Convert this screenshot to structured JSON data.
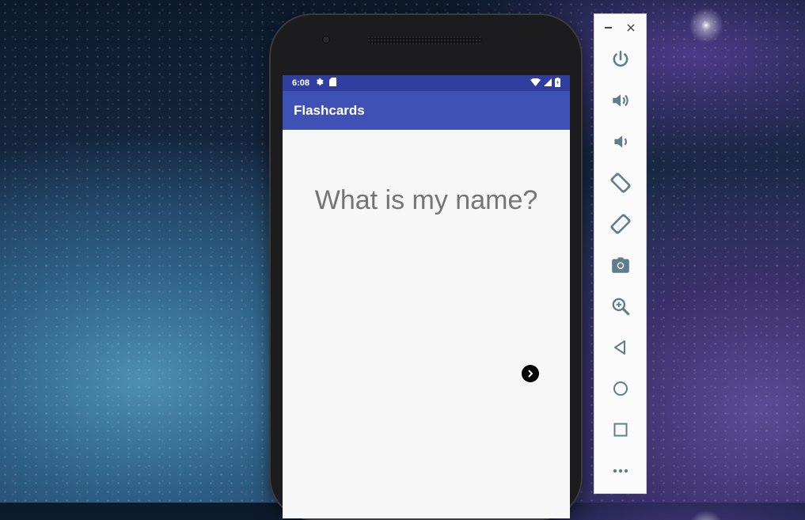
{
  "status_bar": {
    "time": "6:08",
    "left_icons": [
      "settings-icon",
      "sd-card-icon"
    ],
    "right_icons": [
      "wifi-icon",
      "signal-icon",
      "battery-icon"
    ]
  },
  "app": {
    "title": "Flashcards",
    "question": "What is my name?",
    "next_button_icon": "chevron-right-icon"
  },
  "emulator_toolbar": {
    "window_controls": [
      "minimize-icon",
      "close-icon"
    ],
    "tools": [
      "power",
      "volume-up",
      "volume-down",
      "rotate-left",
      "rotate-right",
      "camera",
      "zoom",
      "back",
      "home",
      "overview",
      "more"
    ]
  },
  "colors": {
    "status_bar": "#303f9f",
    "app_bar": "#3f51b5",
    "screen_bg": "#f7f7f7",
    "question_text": "#757575",
    "toolbar_icons": "#607d8b"
  }
}
